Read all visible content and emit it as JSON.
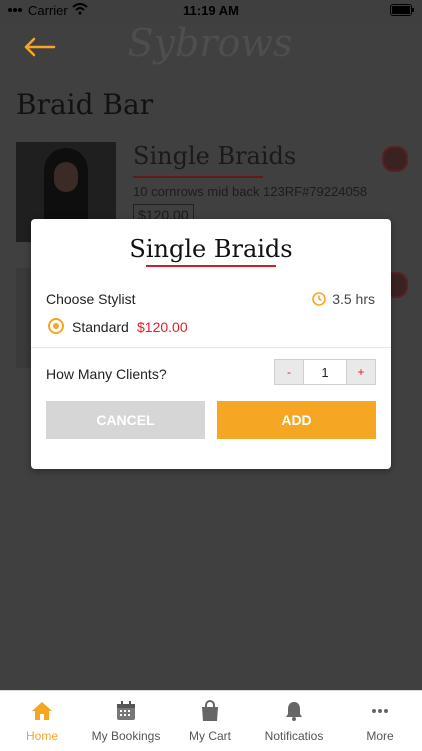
{
  "status_bar": {
    "carrier": "Carrier",
    "time": "11:19 AM"
  },
  "header": {
    "logo_text": "Sybrows",
    "back_icon": "arrow-left-icon"
  },
  "section": {
    "title": "Braid Bar"
  },
  "services": [
    {
      "name": "Single Braids",
      "description": "10 cornrows mid back 123RF#79224058",
      "price": "$120.00"
    }
  ],
  "modal": {
    "title": "Single Braids",
    "choose_stylist_label": "Choose Stylist",
    "duration": "3.5 hrs",
    "stylist": {
      "name": "Standard",
      "price": "$120.00",
      "selected": true
    },
    "clients_label": "How Many Clients?",
    "quantity": "1",
    "minus_label": "-",
    "plus_label": "+",
    "cancel_label": "CANCEL",
    "add_label": "ADD"
  },
  "tabbar": {
    "items": [
      {
        "label": "Home",
        "icon": "home-icon",
        "active": true
      },
      {
        "label": "My Bookings",
        "icon": "calendar-icon"
      },
      {
        "label": "My Cart",
        "icon": "shopping-bag-icon"
      },
      {
        "label": "Notificatios",
        "icon": "bell-icon"
      },
      {
        "label": "More",
        "icon": "more-dots-icon"
      }
    ]
  },
  "colors": {
    "accent": "#f5a623",
    "price_red": "#e0202a",
    "underline_red": "#cc1f2a"
  }
}
